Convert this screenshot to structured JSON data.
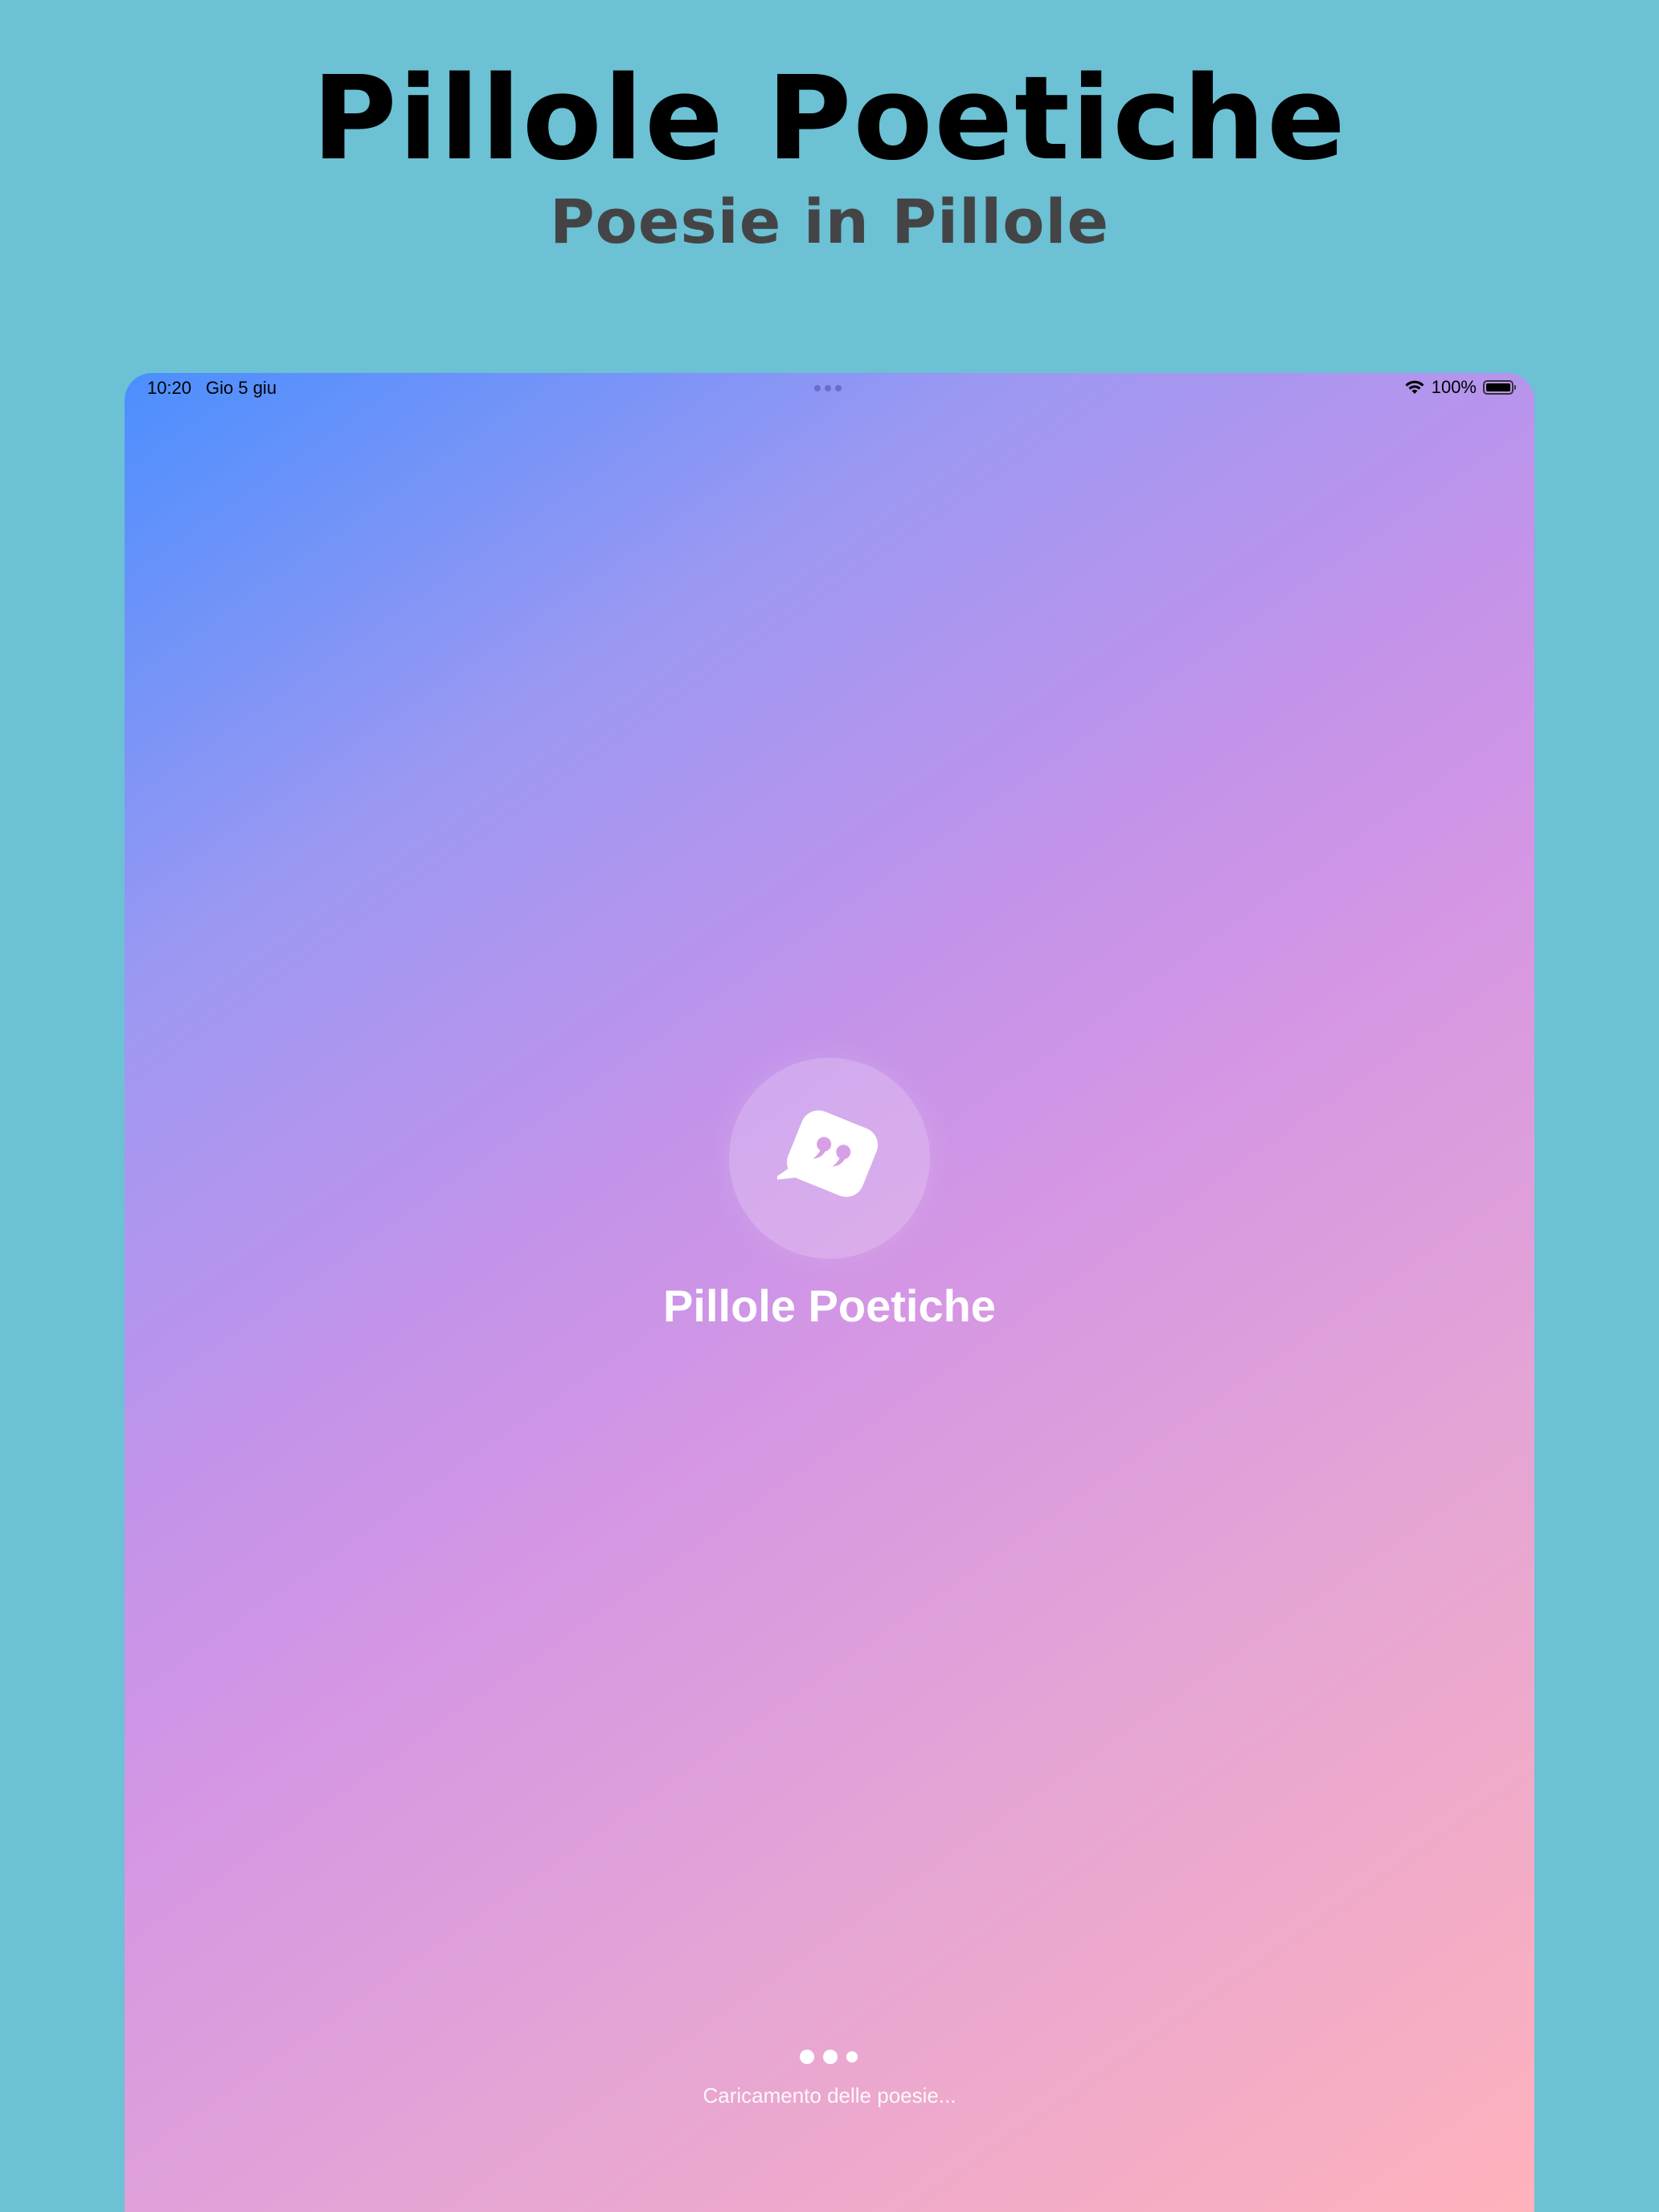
{
  "promo": {
    "title": "Pillole Poetiche",
    "subtitle": "Poesie in Pillole"
  },
  "status_bar": {
    "time": "10:20",
    "date": "Gio 5 giu",
    "battery_percent": "100%",
    "icons": [
      "multitasking-dots-icon",
      "wifi-icon",
      "battery-icon"
    ]
  },
  "app": {
    "logo_icon": "quote-bubble-icon",
    "title": "Pillole Poetiche",
    "loading_text": "Caricamento delle poesie..."
  },
  "colors": {
    "page_background": "#6cc1d4",
    "gradient_start": "#4b8ffe",
    "gradient_mid": "#d596e4",
    "gradient_end": "#ffb2bb"
  }
}
